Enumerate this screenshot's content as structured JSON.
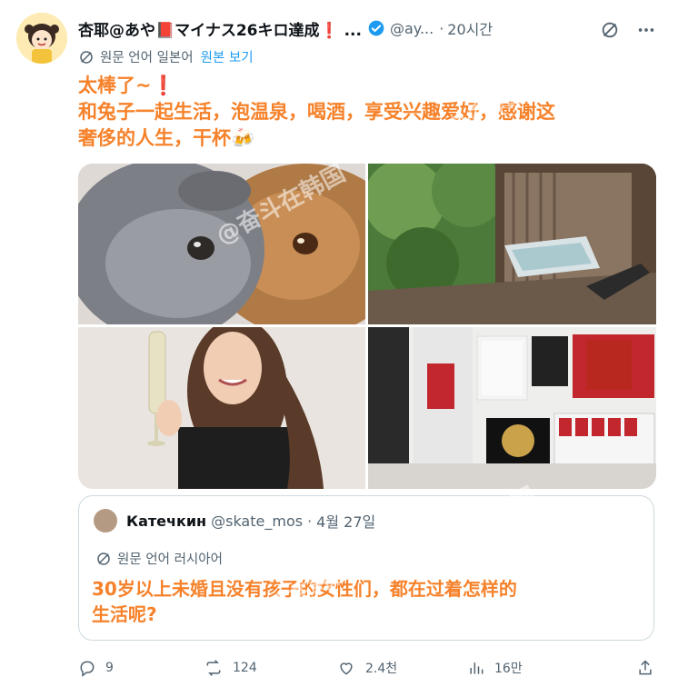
{
  "post": {
    "display_name": "杏耶@あや📕マイナス26キロ達成❗ ...",
    "handle": "@ay...",
    "dot": "·",
    "time": "20시간",
    "translation_note": "원문 언어 일본어",
    "translation_link": "원본 보기",
    "text_lines": [
      "太棒了~❗",
      "和兔子一起生活，泡温泉，喝酒，享受兴趣爱好，感谢这",
      "奢侈的人生，干杯🍻"
    ],
    "media_alt": [
      "rabbits photo",
      "outdoor bath photo",
      "woman with champagne photo",
      "slam dunk collection photo"
    ]
  },
  "quote": {
    "name": "Катечкин",
    "handle": "@skate_mos",
    "dot": "·",
    "date": "4월 27일",
    "translation_note": "원문 언어 러시아어",
    "text_lines": [
      "30岁以上未婚且没有孩子的女性们，都在过着怎样的",
      "生活呢?"
    ]
  },
  "actions": {
    "replies": "9",
    "reposts": "124",
    "likes": "2.4천",
    "views": "16만"
  },
  "watermark": "@奋斗在韩国",
  "colors": {
    "accent_text": "#f6822b",
    "link": "#1d9bf0",
    "verified": "#1d9bf0",
    "muted": "#536471"
  },
  "icons": [
    "avatar-icon",
    "verified-icon",
    "grok-icon",
    "more-icon",
    "translate-icon",
    "reply-icon",
    "repost-icon",
    "like-icon",
    "views-icon",
    "share-icon"
  ]
}
